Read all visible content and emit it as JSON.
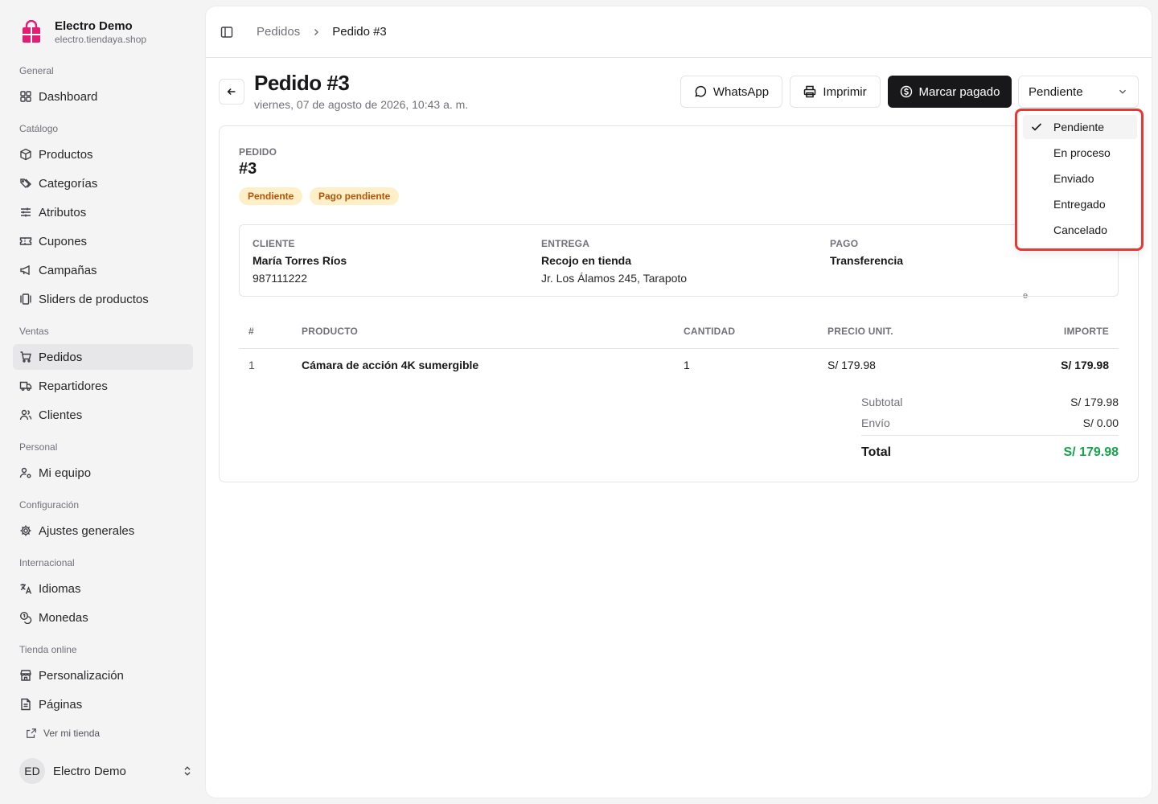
{
  "sidebar": {
    "brand": {
      "name": "Electro Demo",
      "domain": "electro.tiendaya.shop"
    },
    "groups": {
      "general": "General",
      "catalogo": "Catálogo",
      "ventas": "Ventas",
      "personal": "Personal",
      "configuracion": "Configuración",
      "internacional": "Internacional",
      "tienda": "Tienda online"
    },
    "items": {
      "dashboard": "Dashboard",
      "productos": "Productos",
      "categorias": "Categorías",
      "atributos": "Atributos",
      "cupones": "Cupones",
      "campanas": "Campañas",
      "sliders": "Sliders de productos",
      "pedidos": "Pedidos",
      "repartidores": "Repartidores",
      "clientes": "Clientes",
      "equipo": "Mi equipo",
      "ajustes": "Ajustes generales",
      "idiomas": "Idiomas",
      "monedas": "Monedas",
      "personalizacion": "Personalización",
      "paginas": "Páginas"
    },
    "active_item": "pedidos",
    "ver_tienda": "Ver mi tienda",
    "user": {
      "initials": "ED",
      "name": "Electro Demo"
    }
  },
  "breadcrumb": {
    "parent": "Pedidos",
    "current": "Pedido #3"
  },
  "header": {
    "title": "Pedido #3",
    "date": "viernes, 07 de agosto de 2026, 10:43 a. m.",
    "whatsapp": "WhatsApp",
    "imprimir": "Imprimir",
    "marcar_pagado": "Marcar pagado",
    "status_value": "Pendiente"
  },
  "status_menu": {
    "options": [
      "Pendiente",
      "En proceso",
      "Enviado",
      "Entregado",
      "Cancelado"
    ],
    "selected": "Pendiente"
  },
  "order": {
    "label": "PEDIDO",
    "number": "#3",
    "edge_text": "e",
    "badges": {
      "status": "Pendiente",
      "payment": "Pago pendiente"
    },
    "cliente": {
      "label": "CLIENTE",
      "name": "María Torres Ríos",
      "phone": "987111222"
    },
    "entrega": {
      "label": "ENTREGA",
      "method": "Recojo en tienda",
      "address": "Jr. Los Álamos 245, Tarapoto"
    },
    "pago": {
      "label": "PAGO",
      "method": "Transferencia"
    }
  },
  "table": {
    "headers": {
      "num": "#",
      "producto": "PRODUCTO",
      "cantidad": "CANTIDAD",
      "precio": "PRECIO UNIT.",
      "importe": "IMPORTE"
    },
    "rows": [
      {
        "num": "1",
        "producto": "Cámara de acción 4K sumergible",
        "cantidad": "1",
        "precio": "S/ 179.98",
        "importe": "S/ 179.98"
      }
    ]
  },
  "summary": {
    "subtotal_label": "Subtotal",
    "subtotal": "S/ 179.98",
    "envio_label": "Envío",
    "envio": "S/ 0.00",
    "total_label": "Total",
    "total": "S/ 179.98"
  },
  "colors": {
    "accent_brand": "#e11d74",
    "total_green": "#16a34a",
    "badge_bg": "#fdf0c8",
    "badge_text": "#b45309",
    "highlight_border": "#e53935"
  }
}
